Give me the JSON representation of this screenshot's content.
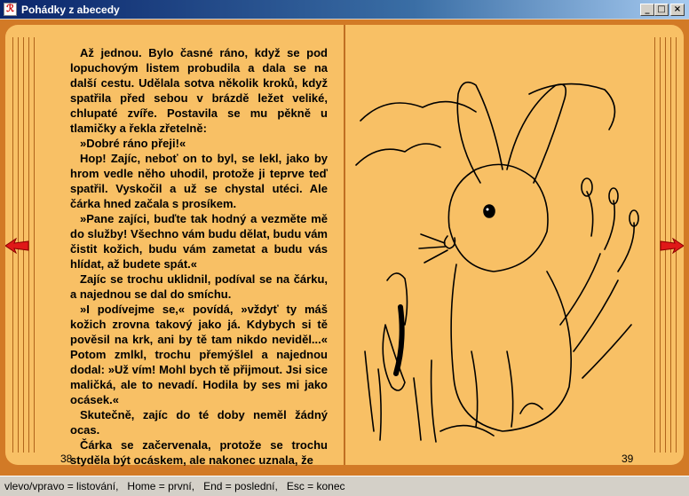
{
  "window": {
    "title": "Pohádky z abecedy"
  },
  "window_buttons": {
    "minimize": "_",
    "maximize": "□",
    "close": "×"
  },
  "book": {
    "left_page_number": "38",
    "right_page_number": "39",
    "paragraphs": [
      "Až jednou. Bylo časné ráno, když se pod lopuchovým listem probudila a dala se na další cestu. Udělala sotva několik kroků, když spatřila před sebou v brázdě ležet veliké, chlupaté zvíře. Postavila se mu pěkně u tlamičky a řekla zřetelně:",
      "»Dobré ráno přeji!«",
      "Hop! Zajíc, neboť on to byl, se lekl, jako by hrom vedle něho uhodil, protože ji teprve teď spatřil. Vyskočil a už se chystal utéci. Ale čárka hned začala s prosíkem.",
      "»Pane zajíci, buďte tak hodný a vezměte mě do služby! Všechno vám budu dělat, budu vám čistit kožich, budu vám zametat a budu vás hlídat, až budete spát.«",
      "Zajíc se trochu uklidnil, podíval se na čárku, a najednou se dal do smíchu.",
      "»I podívejme se,« povídá, »vždyť ty máš kožich zrovna takový jako já. Kdybych si tě pověsil na krk, ani by tě tam nikdo neviděl...« Potom zmlkl, trochu přemýšlel a najednou dodal: »Už vím! Mohl bych tě přijmout. Jsi sice maličká, ale to nevadí. Hodila by ses mi jako ocásek.«",
      "Skutečně, zajíc do té doby neměl žádný ocas.",
      "Čárka se začervenala, protože se trochu styděla být ocáskem, ale nakonec uznala, že"
    ]
  },
  "status_bar": {
    "text": "vlevo/vpravo = listování,   Home = první,   End = poslední,   Esc = konec"
  },
  "colors": {
    "frame": "#d27a26",
    "page": "#f8c065",
    "arrow": "#e01818",
    "titlebar": "#0a246a"
  },
  "icons": [
    "app-icon",
    "prev-page-arrow-icon",
    "next-page-arrow-icon"
  ]
}
